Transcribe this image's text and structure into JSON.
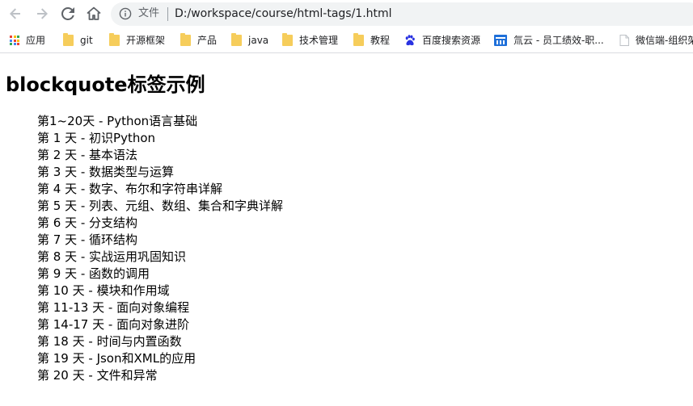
{
  "browser": {
    "scheme_label": "文件",
    "url": "D:/workspace/course/html-tags/1.html"
  },
  "bookmarks": [
    {
      "label": "应用",
      "icon": "apps-grid-icon"
    },
    {
      "label": "git",
      "icon": "folder-icon"
    },
    {
      "label": "开源框架",
      "icon": "folder-icon"
    },
    {
      "label": "产品",
      "icon": "folder-icon"
    },
    {
      "label": "java",
      "icon": "folder-icon"
    },
    {
      "label": "技术管理",
      "icon": "folder-icon"
    },
    {
      "label": "教程",
      "icon": "folder-icon"
    },
    {
      "label": "百度搜索资源",
      "icon": "baidu-paw-icon"
    },
    {
      "label": "氚云 - 员工绩效-职...",
      "icon": "chuanyun-icon"
    },
    {
      "label": "微信端-组织架",
      "icon": "page-icon"
    }
  ],
  "content": {
    "heading": "blockquote标签示例",
    "lines": [
      "第1~20天 - Python语言基础",
      "第 1 天 - 初识Python",
      "第 2 天 - 基本语法",
      "第 3 天 - 数据类型与运算",
      "第 4 天 - 数字、布尔和字符串详解",
      "第 5 天 - 列表、元组、数组、集合和字典详解",
      "第 6 天 - 分支结构",
      "第 7 天 - 循环结构",
      "第 8 天 - 实战运用巩固知识",
      "第 9 天 - 函数的调用",
      "第 10 天 - 模块和作用域",
      "第 11-13 天 - 面向对象编程",
      "第 14-17 天 - 面向对象进阶",
      "第 18 天 - 时间与内置函数",
      "第 19 天 - Json和XML的应用",
      "第 20 天 - 文件和异常"
    ]
  },
  "colors": {
    "folder": "#f6cd5b",
    "omnibox_bg": "#f1f3f4",
    "baidu": "#2932e1",
    "chuanyun": "#1e6fd9"
  }
}
